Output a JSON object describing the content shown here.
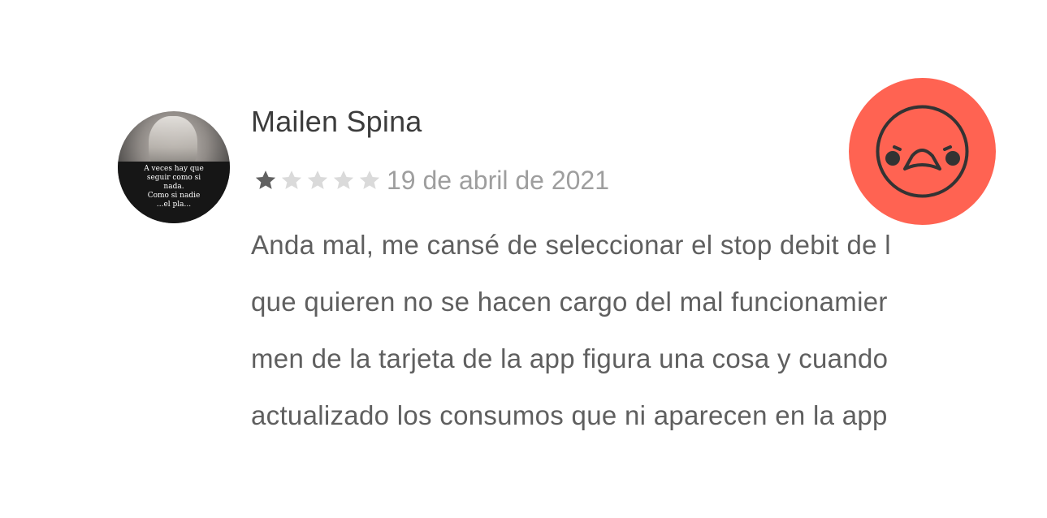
{
  "review": {
    "author": {
      "name": "Mailen Spina",
      "avatar_caption": "A veces hay que\nseguir como si\nnada.\nComo si nadie\n...el pla..."
    },
    "rating": {
      "value": 1,
      "max": 5,
      "filled_color": "#616161",
      "empty_color": "#dadada"
    },
    "date": "19 de abril de 2021",
    "text_lines": [
      "Anda mal, me cansé de seleccionar el stop debit de l",
      "que quieren no se hacen cargo del mal funcionamier",
      "men de la tarjeta de la app figura una cosa y cuando",
      "actualizado los consumos que ni aparecen en la app"
    ]
  },
  "sentiment": {
    "icon": "angry-face-icon",
    "color": "#ff6352"
  }
}
